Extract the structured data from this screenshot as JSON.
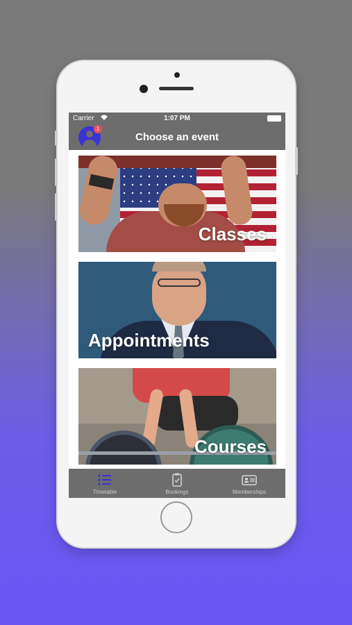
{
  "statusbar": {
    "carrier": "Carrier",
    "time": "1:07 PM"
  },
  "navbar": {
    "title": "Choose an event",
    "notification_count": "1",
    "avatar_icon": "user-icon"
  },
  "cards": [
    {
      "label": "Classes",
      "image": "man-lifting-barbell-flag-photo"
    },
    {
      "label": "Appointments",
      "image": "man-in-suit-portrait-photo"
    },
    {
      "label": "Courses",
      "image": "deadlift-weights-photo"
    }
  ],
  "tabs": [
    {
      "label": "Timetable",
      "icon": "list-icon",
      "active": true
    },
    {
      "label": "Bookings",
      "icon": "clipboard-check-icon",
      "active": false
    },
    {
      "label": "Memberships",
      "icon": "id-card-icon",
      "active": false
    }
  ],
  "colors": {
    "accent": "#3b33d4",
    "bar_background": "#6d6d6d",
    "badge": "#e8505b",
    "background_gradient_end": "#6a56f5"
  }
}
